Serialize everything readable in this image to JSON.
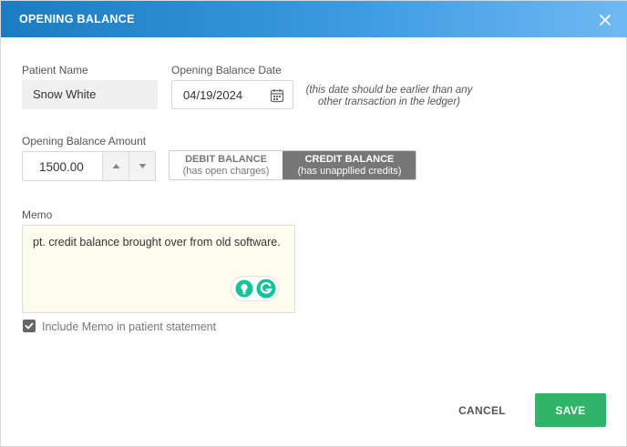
{
  "dialog": {
    "title": "OPENING BALANCE",
    "close_icon": "close-icon"
  },
  "patient": {
    "label": "Patient Name",
    "value": "Snow White"
  },
  "opening_date": {
    "label": "Opening Balance Date",
    "value": "04/19/2024",
    "icon": "calendar-icon",
    "note_line1": "(this date should be earlier than any",
    "note_line2": "other transaction in the ledger)"
  },
  "amount": {
    "label": "Opening Balance Amount",
    "value": "1500.00",
    "up_icon": "chevron-up-icon",
    "down_icon": "chevron-down-icon"
  },
  "balance_type": {
    "selected": "credit",
    "debit": {
      "label": "DEBIT BALANCE",
      "sub": "(has open charges)"
    },
    "credit": {
      "label": "CREDIT BALANCE",
      "sub": "(has unappllied credits)"
    }
  },
  "memo": {
    "label": "Memo",
    "value": "pt. credit balance brought over from old software.",
    "include_label": "Include Memo in patient statement",
    "include_checked": true
  },
  "actions": {
    "cancel_label": "CANCEL",
    "save_label": "SAVE"
  },
  "colors": {
    "header_start": "#1a7cc1",
    "header_end": "#6fb9f3",
    "selected_toggle": "#777777",
    "save_green": "#2fb46a",
    "memo_bg": "#fefcef",
    "grammarly_green": "#15c39a"
  }
}
